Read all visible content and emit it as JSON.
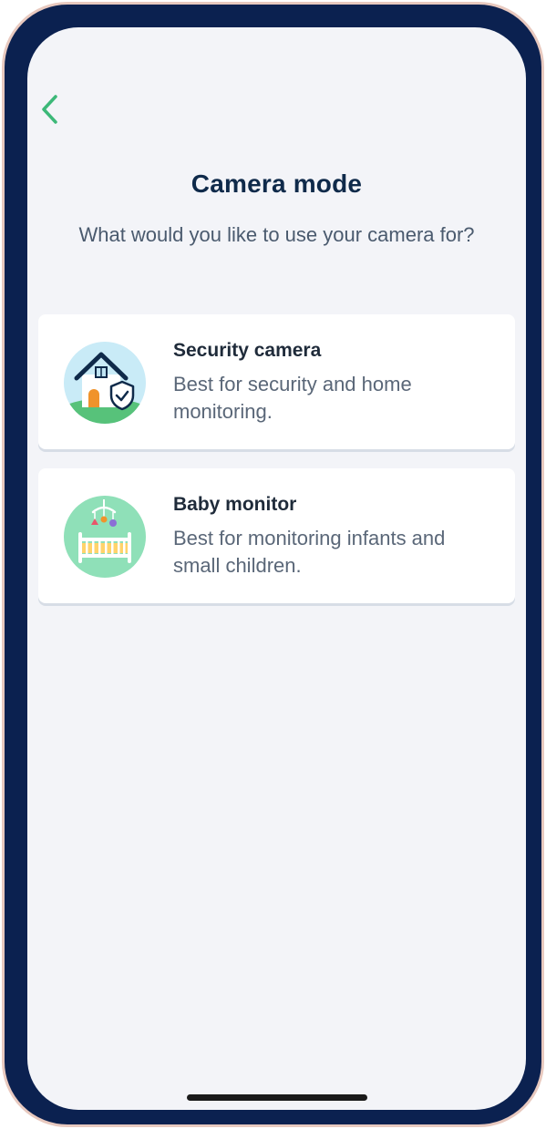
{
  "header": {
    "title": "Camera mode",
    "subtitle": "What would you like to use your camera for?"
  },
  "options": [
    {
      "name": "Security camera",
      "description": "Best for security and home monitoring.",
      "icon": "house-shield-icon"
    },
    {
      "name": "Baby monitor",
      "description": "Best for monitoring infants and small children.",
      "icon": "crib-icon"
    }
  ],
  "colors": {
    "accent": "#3cb878",
    "frame": "#0b2150",
    "background": "#f3f4f8"
  }
}
